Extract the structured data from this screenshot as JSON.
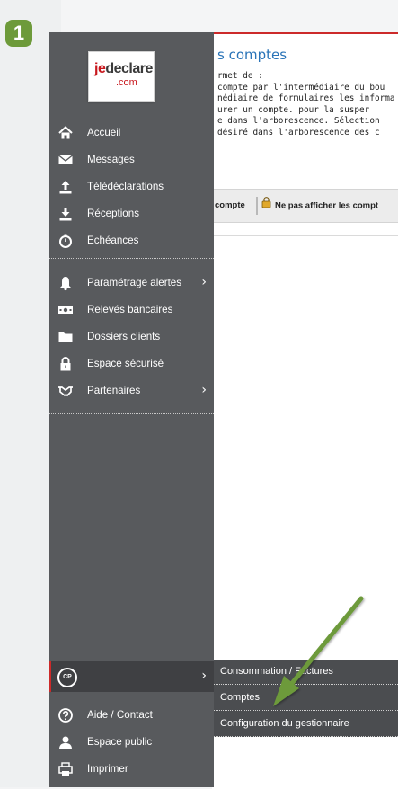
{
  "step": {
    "number": "1",
    "color": "#6d9a3a"
  },
  "page": {
    "title": "s comptes",
    "desc_lines": [
      "rmet de :",
      "compte par l'intermédiaire du bou",
      "nédiaire de formulaires les informa",
      "urer un compte.  pour la susper",
      "e dans l'arborescence. Sélection",
      " désiré dans l'arborescence des c"
    ],
    "toolbar": {
      "btn1": "compte",
      "btn2": "Ne pas afficher les compt"
    }
  },
  "sidebar": {
    "logo": {
      "je": "je",
      "declare": "declare",
      "com": ".com"
    },
    "items": [
      {
        "label": "Accueil",
        "icon": "home-icon"
      },
      {
        "label": "Messages",
        "icon": "envelope-icon"
      },
      {
        "label": "Télédéclarations",
        "icon": "upload-icon"
      },
      {
        "label": "Réceptions",
        "icon": "download-icon"
      },
      {
        "label": "Echéances",
        "icon": "stopwatch-icon"
      },
      {
        "label": "Paramétrage alertes",
        "icon": "bell-icon",
        "chevron": "›"
      },
      {
        "label": "Relevés bancaires",
        "icon": "banknote-icon"
      },
      {
        "label": "Dossiers clients",
        "icon": "folder-icon"
      },
      {
        "label": "Espace sécurisé",
        "icon": "lock-icon"
      },
      {
        "label": "Partenaires",
        "icon": "handshake-icon",
        "chevron": "›"
      }
    ],
    "cp": {
      "label": "CP",
      "chevron": "›"
    },
    "bottom_items": [
      {
        "label": "Aide / Contact",
        "icon": "help-icon"
      },
      {
        "label": "Espace public",
        "icon": "user-icon"
      },
      {
        "label": "Imprimer",
        "icon": "printer-icon"
      }
    ]
  },
  "submenu": {
    "items": [
      "Consommation / Factures",
      "Comptes",
      "Configuration du gestionnaire"
    ]
  },
  "colors": {
    "sidebar": "#585a5d",
    "accent_red": "#cc2a2a",
    "title_blue": "#2a74b8",
    "arrow_green": "#6d9a3a"
  }
}
